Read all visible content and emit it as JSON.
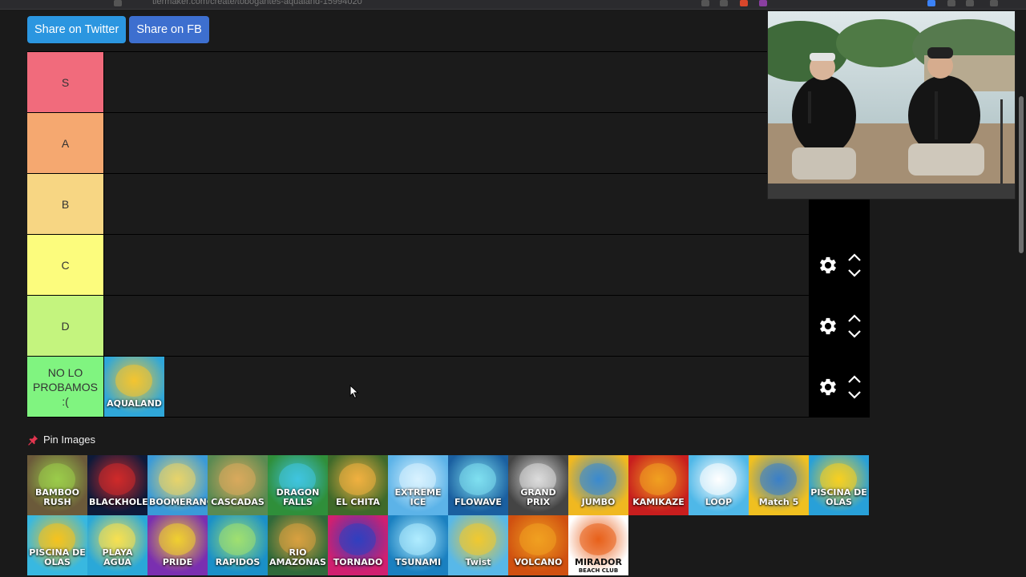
{
  "browser": {
    "url": "tiermaker.com/create/tobogantes-aqualand-15994020"
  },
  "share": {
    "twitter_label": "Share on Twitter",
    "fb_label": "Share on FB"
  },
  "tiers": [
    {
      "label": "S",
      "color": "#f16b7c"
    },
    {
      "label": "A",
      "color": "#f5a870"
    },
    {
      "label": "B",
      "color": "#f7d683"
    },
    {
      "label": "C",
      "color": "#fcfc7d"
    },
    {
      "label": "D",
      "color": "#c4f47e"
    },
    {
      "label": "NO LO PROBAMOS :(",
      "color": "#80f480"
    }
  ],
  "tier_items": {
    "nolo": [
      {
        "label": "AQUALAND",
        "bg": "#2fa7d9",
        "accent": "#f4c430"
      }
    ]
  },
  "pin_section": {
    "label": "Pin Images",
    "icon": "pushpin-icon"
  },
  "pool_items": [
    {
      "label": "BAMBOO RUSH",
      "bg": "#6b5a3a",
      "accent": "#9bcc4a"
    },
    {
      "label": "BLACKHOLE",
      "bg": "#0e1a3a",
      "accent": "#d02a2a"
    },
    {
      "label": "BOOMERANG",
      "bg": "#3a9ad8",
      "accent": "#e8d46a"
    },
    {
      "label": "CASCADAS",
      "bg": "#5a8a52",
      "accent": "#d9a95c"
    },
    {
      "label": "DRAGON FALLS",
      "bg": "#2f8f3a",
      "accent": "#3fc4e0"
    },
    {
      "label": "EL CHITA",
      "bg": "#3f6a2a",
      "accent": "#f0b040"
    },
    {
      "label": "EXTREME ICE",
      "bg": "#5cb3e8",
      "accent": "#d8f2ff"
    },
    {
      "label": "FLOWAVE",
      "bg": "#1a5fa0",
      "accent": "#7fe0f0"
    },
    {
      "label": "GRAND PRIX",
      "bg": "#444444",
      "accent": "#dddddd"
    },
    {
      "label": "JUMBO",
      "bg": "#f0b820",
      "accent": "#3a8ad0"
    },
    {
      "label": "KAMIKAZE",
      "bg": "#c81e1e",
      "accent": "#f0a020"
    },
    {
      "label": "LOOP",
      "bg": "#4fb8e8",
      "accent": "#ffffff"
    },
    {
      "label": "Match 5",
      "bg": "#f0c020",
      "accent": "#3a80c8"
    },
    {
      "label": "PISCINA DE OLAS",
      "bg": "#28a0d8",
      "accent": "#f8d020"
    },
    {
      "label": "PISCINA DE OLAS",
      "bg": "#38b8e0",
      "accent": "#f6c21e"
    },
    {
      "label": "PLAYA AGUA",
      "bg": "#2aa8d8",
      "accent": "#f8e050"
    },
    {
      "label": "PRIDE",
      "bg": "#7a2fb0",
      "accent": "#f0d030"
    },
    {
      "label": "RAPIDOS",
      "bg": "#1a90c8",
      "accent": "#a0e070"
    },
    {
      "label": "RIO AMAZONAS",
      "bg": "#2f6a3a",
      "accent": "#d8a040"
    },
    {
      "label": "TORNADO",
      "bg": "#d02070",
      "accent": "#3040c0"
    },
    {
      "label": "TSUNAMI",
      "bg": "#1a80c0",
      "accent": "#b0ecff"
    },
    {
      "label": "Twist",
      "bg": "#58b8e8",
      "accent": "#f0c830"
    },
    {
      "label": "VOLCANO",
      "bg": "#d05010",
      "accent": "#f0a020"
    },
    {
      "label": "MIRADOR",
      "sub": "BEACH CLUB",
      "bg": "#ffffff",
      "accent": "#e8601a",
      "dark": true
    }
  ]
}
